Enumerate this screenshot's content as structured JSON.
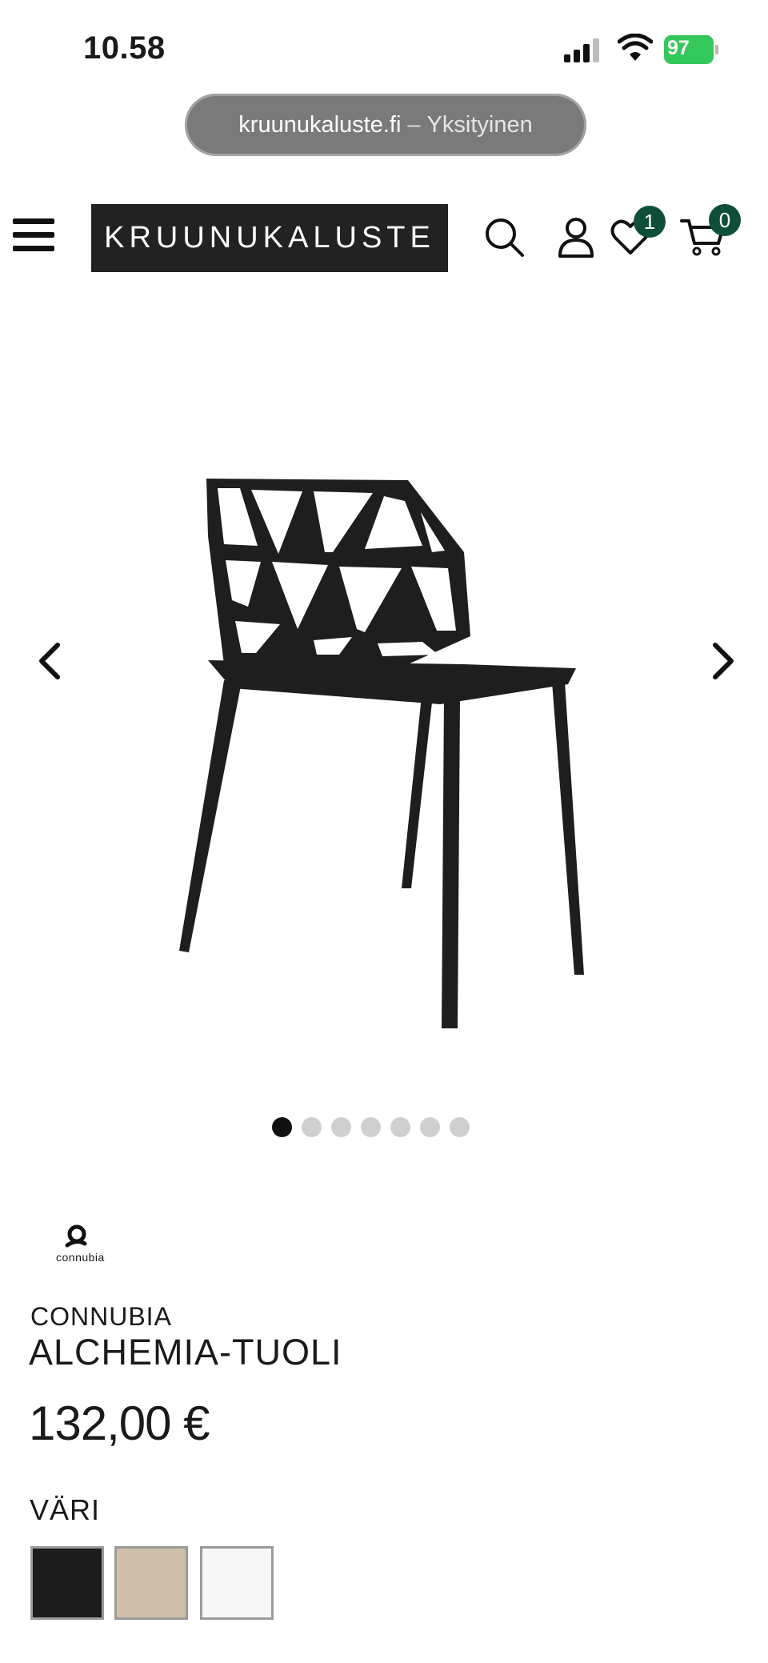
{
  "status_bar": {
    "time": "10.58",
    "battery_level": "97"
  },
  "browser": {
    "domain": "kruunukaluste.fi",
    "separator": "–",
    "mode": "Yksityinen"
  },
  "header": {
    "logo_text": "KRUUNUKALUSTE",
    "wishlist_count": "1",
    "cart_count": "0",
    "icons": [
      "menu-icon",
      "search-icon",
      "account-icon",
      "heart-icon",
      "cart-icon"
    ]
  },
  "gallery": {
    "total_images": 7,
    "active_index": 0
  },
  "product": {
    "brand_logo_text": "connubia",
    "brand": "CONNUBIA",
    "title": "ALCHEMIA-TUOLI",
    "price": "132,00 €",
    "color_label": "VÄRI",
    "colors": [
      {
        "name": "black",
        "hex": "#1c1c1c"
      },
      {
        "name": "beige",
        "hex": "#cfbeaa"
      },
      {
        "name": "white",
        "hex": "#f6f6f6"
      }
    ]
  },
  "colors": {
    "badge": "#0f4f3a",
    "logo_bg": "#222222",
    "battery": "#34c759"
  }
}
